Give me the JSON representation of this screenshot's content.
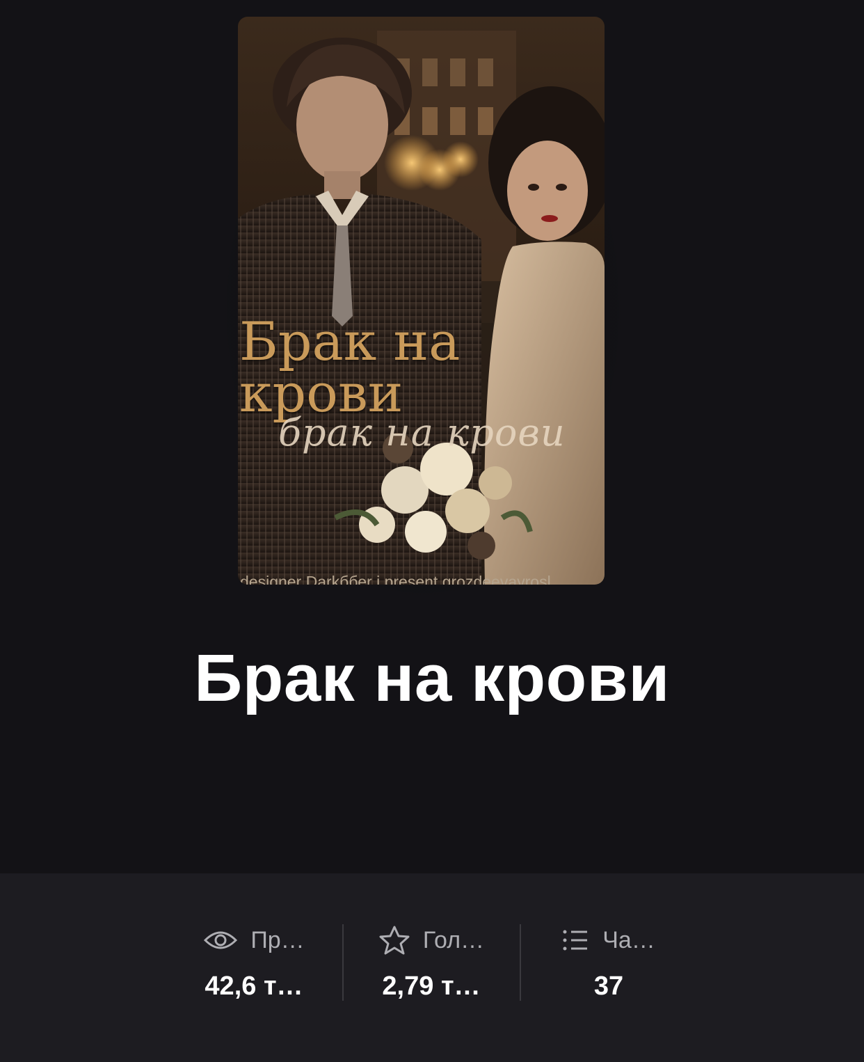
{
  "cover": {
    "title_text": "Брак на\nкрови",
    "script_text": "брак на крови",
    "credit_text": "designer Darkббеr i present grozdeevayrosl"
  },
  "book": {
    "title": "Брак на крови"
  },
  "stats": [
    {
      "icon": "eye-icon",
      "label": "Пр…",
      "value": "42,6 т…"
    },
    {
      "icon": "star-icon",
      "label": "Гол…",
      "value": "2,79 т…"
    },
    {
      "icon": "list-icon",
      "label": "Ча…",
      "value": "37"
    }
  ],
  "colors": {
    "background": "#131216",
    "stats_panel": "#1d1c21",
    "title_text": "#ffffff",
    "label_text": "#aeaeb3",
    "cover_gold": "#c99a5a"
  }
}
